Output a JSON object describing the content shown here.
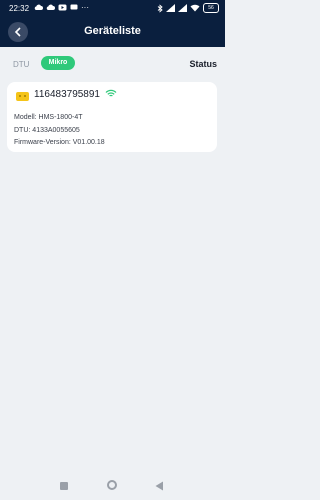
{
  "status_bar": {
    "time": "22:32",
    "battery_level": "56",
    "left_icons": [
      "cloud-icon",
      "cloud-icon",
      "youtube-icon",
      "message-icon",
      "more-icon"
    ],
    "right_icons": [
      "bluetooth-icon",
      "signal-icon",
      "signal-icon",
      "wifi-icon",
      "battery-icon"
    ]
  },
  "header": {
    "title": "Geräteliste"
  },
  "tabs": {
    "dtu": "DTU",
    "mikro": "Mikro",
    "active": "Mikro"
  },
  "status_label": "Status",
  "device": {
    "serial": "116483795891",
    "model_label": "Modell:",
    "model_value": "HMS-1800-4T",
    "dtu_label": "DTU:",
    "dtu_value": "4133A0055605",
    "firmware_label": "Firmware-Version:",
    "firmware_value": "V01.00.18",
    "icon": "inverter-icon",
    "signal_icon": "wifi-icon"
  },
  "colors": {
    "header_bg": "#0a1f3e",
    "accent": "#2fc97a",
    "device_icon": "#f5c419",
    "page_bg": "#eef1f4"
  },
  "nav": {
    "buttons": [
      "recents-icon",
      "home-icon",
      "back-icon"
    ]
  }
}
